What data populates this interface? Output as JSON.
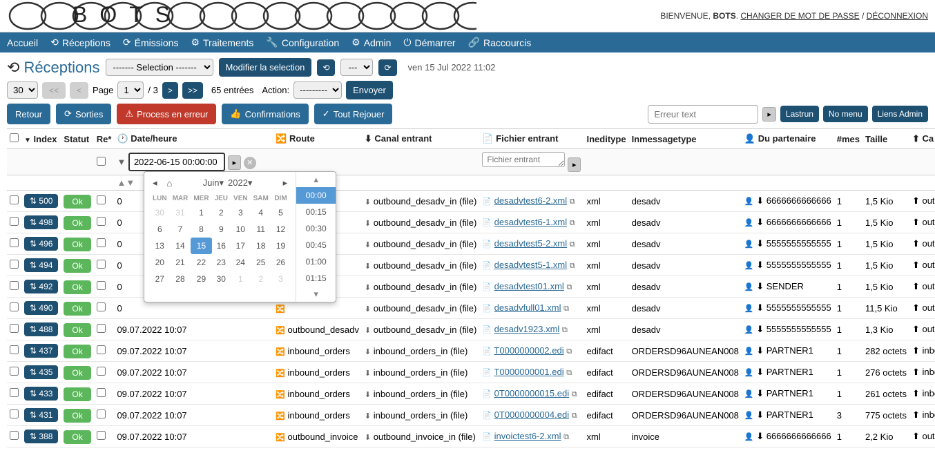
{
  "welcome": {
    "prefix": "BIENVENUE,",
    "user": "BOTS",
    "change_pw": "CHANGER DE MOT DE PASSE",
    "logout": "DÉCONNEXION"
  },
  "nav": {
    "home": "Accueil",
    "receptions": "Réceptions",
    "emissions": "Émissions",
    "treatments": "Traitements",
    "config": "Configuration",
    "admin": "Admin",
    "start": "Démarrer",
    "shortcuts": "Raccourcis"
  },
  "page_title": "Réceptions",
  "selection_placeholder": "------- Selection -------",
  "modify_btn": "Modifier la selection",
  "dash_placeholder": "---",
  "timestamp": "ven 15 Jul 2022  11:02",
  "pager": {
    "page_label": "Page",
    "page_count": "/ 3",
    "entries": "65 entrées",
    "action_label": "Action:",
    "action_placeholder": "---------",
    "submit": "Envoyer"
  },
  "actions": {
    "back": "Retour",
    "sorties": "Sorties",
    "process_err": "Process en erreur",
    "confirmations": "Confirmations",
    "rejouer": "Tout Rejouer",
    "error_text": "Erreur text",
    "lastrun": "Lastrun",
    "nomenu": "No menu",
    "liens": "Liens Admin"
  },
  "cols": {
    "index": "Index",
    "statut": "Statut",
    "re": "Re*",
    "date": "Date/heure",
    "route": "Route",
    "canal": "Canal entrant",
    "fichier": "Fichier entrant",
    "ineditype": "Ineditype",
    "inmsg": "Inmessagetype",
    "partenaire": "Du partenaire",
    "mes": "#mes",
    "taille": "Taille",
    "ca": "Ca"
  },
  "filter": {
    "date_val": "2022-06-15 00:00:00",
    "file_ph": "Fichier entrant"
  },
  "datepicker": {
    "month": "Juin",
    "year": "2022",
    "weekdays": [
      "LUN",
      "MAR",
      "MER",
      "JEU",
      "VEN",
      "SAM",
      "DIM"
    ],
    "weeks": [
      [
        "30",
        "31",
        "1",
        "2",
        "3",
        "4",
        "5"
      ],
      [
        "6",
        "7",
        "8",
        "9",
        "10",
        "11",
        "12"
      ],
      [
        "13",
        "14",
        "15",
        "16",
        "17",
        "18",
        "19"
      ],
      [
        "20",
        "21",
        "22",
        "23",
        "24",
        "25",
        "26"
      ],
      [
        "27",
        "28",
        "29",
        "30",
        "1",
        "2",
        "3"
      ]
    ],
    "times": [
      "00:00",
      "00:15",
      "00:30",
      "00:45",
      "01:00",
      "01:15"
    ]
  },
  "rows": [
    {
      "idx": "500",
      "status": "Ok",
      "date": "0",
      "route": "",
      "canal": "outbound_desadv_in (file)",
      "file": "desadvtest6-2.xml",
      "ineditype": "xml",
      "inmsg": "desadv",
      "part": "6666666666666",
      "mes": "1",
      "taille": "1,5 Kio",
      "ca": "out"
    },
    {
      "idx": "498",
      "status": "Ok",
      "date": "0",
      "route": "",
      "canal": "outbound_desadv_in (file)",
      "file": "desadvtest6-1.xml",
      "ineditype": "xml",
      "inmsg": "desadv",
      "part": "6666666666666",
      "mes": "1",
      "taille": "1,5 Kio",
      "ca": "out"
    },
    {
      "idx": "496",
      "status": "Ok",
      "date": "0",
      "route": "",
      "canal": "outbound_desadv_in (file)",
      "file": "desadvtest5-2.xml",
      "ineditype": "xml",
      "inmsg": "desadv",
      "part": "5555555555555",
      "mes": "1",
      "taille": "1,5 Kio",
      "ca": "out"
    },
    {
      "idx": "494",
      "status": "Ok",
      "date": "0",
      "route": "",
      "canal": "outbound_desadv_in (file)",
      "file": "desadvtest5-1.xml",
      "ineditype": "xml",
      "inmsg": "desadv",
      "part": "5555555555555",
      "mes": "1",
      "taille": "1,5 Kio",
      "ca": "out"
    },
    {
      "idx": "492",
      "status": "Ok",
      "date": "0",
      "route": "",
      "canal": "outbound_desadv_in (file)",
      "file": "desadvtest01.xml",
      "ineditype": "xml",
      "inmsg": "desadv",
      "part": "SENDER",
      "mes": "1",
      "taille": "1,5 Kio",
      "ca": "out"
    },
    {
      "idx": "490",
      "status": "Ok",
      "date": "0",
      "route": "",
      "canal": "outbound_desadv_in (file)",
      "file": "desadvfull01.xml",
      "ineditype": "xml",
      "inmsg": "desadv",
      "part": "5555555555555",
      "mes": "1",
      "taille": "11,5 Kio",
      "ca": "out"
    },
    {
      "idx": "488",
      "status": "Ok",
      "date": "09.07.2022  10:07",
      "route": "outbound_desadv",
      "canal": "outbound_desadv_in (file)",
      "file": "desadv1923.xml",
      "ineditype": "xml",
      "inmsg": "desadv",
      "part": "5555555555555",
      "mes": "1",
      "taille": "1,3 Kio",
      "ca": "out"
    },
    {
      "idx": "437",
      "status": "Ok",
      "date": "09.07.2022  10:07",
      "route": "inbound_orders",
      "canal": "inbound_orders_in (file)",
      "file": "T0000000002.edi",
      "ineditype": "edifact",
      "inmsg": "ORDERSD96AUNEAN008",
      "part": "PARTNER1",
      "mes": "1",
      "taille": "282 octets",
      "ca": "inbo"
    },
    {
      "idx": "435",
      "status": "Ok",
      "date": "09.07.2022  10:07",
      "route": "inbound_orders",
      "canal": "inbound_orders_in (file)",
      "file": "T0000000001.edi",
      "ineditype": "edifact",
      "inmsg": "ORDERSD96AUNEAN008",
      "part": "PARTNER1",
      "mes": "1",
      "taille": "276 octets",
      "ca": "inbo"
    },
    {
      "idx": "433",
      "status": "Ok",
      "date": "09.07.2022  10:07",
      "route": "inbound_orders",
      "canal": "inbound_orders_in (file)",
      "file": "0T0000000015.edi",
      "ineditype": "edifact",
      "inmsg": "ORDERSD96AUNEAN008",
      "part": "PARTNER1",
      "mes": "1",
      "taille": "261 octets",
      "ca": "inbo"
    },
    {
      "idx": "431",
      "status": "Ok",
      "date": "09.07.2022  10:07",
      "route": "inbound_orders",
      "canal": "inbound_orders_in (file)",
      "file": "0T0000000004.edi",
      "ineditype": "edifact",
      "inmsg": "ORDERSD96AUNEAN008",
      "part": "PARTNER1",
      "mes": "3",
      "taille": "775 octets",
      "ca": "inbo"
    },
    {
      "idx": "388",
      "status": "Ok",
      "date": "09.07.2022  10:07",
      "route": "outbound_invoice",
      "canal": "outbound_invoice_in (file)",
      "file": "invoictest6-2.xml",
      "ineditype": "xml",
      "inmsg": "invoice",
      "part": "6666666666666",
      "mes": "1",
      "taille": "2,2 Kio",
      "ca": "out"
    }
  ]
}
